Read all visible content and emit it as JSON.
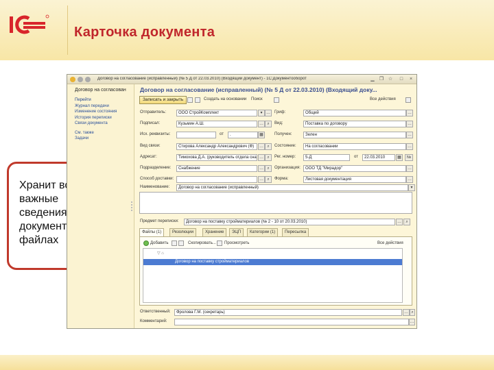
{
  "slide": {
    "title": "Карточка документа",
    "callout": "Хранит все важные сведения о документах и файлах"
  },
  "window": {
    "title": "Договор на согласование (исправленный) (№ 5 Д от 22.03.2010) (Входящий документ) - 1С:Документооборот",
    "form_title": "Договор на согласование (исправленный) (№ 5 Д от 22.03.2010) (Входящий доку...",
    "nav": {
      "header": "Договор на согласован",
      "items": [
        "Перейти",
        "Журнал передачи",
        "Изменение состояния",
        "История переписки",
        "Связи документа"
      ],
      "items2": [
        "См. также",
        "Задачи"
      ]
    },
    "toolbar": {
      "save": "Записать и закрыть",
      "create": "Создать на основании",
      "search": "Поиск",
      "all_actions": "Все действия"
    },
    "left_fields": [
      {
        "label": "Отправитель:",
        "value": "ООО СтройКомплект"
      },
      {
        "label": "Подписал:",
        "value": "Кузьмин А.Ш."
      },
      {
        "label": "Исх. реквизиты:",
        "value": "",
        "date_label": "от",
        "date": "."
      },
      {
        "label": "Вид связи:",
        "value": "Стирова Александр Александрович (Ф)"
      },
      {
        "label": "Адресат:",
        "value": "Тимохова Д.А. (руководитель отдела снаб.)"
      },
      {
        "label": "Подразделение:",
        "value": "Снабжение"
      },
      {
        "label": "Способ доставки:",
        "value": ""
      }
    ],
    "right_fields": [
      {
        "label": "Гриф:",
        "value": "Общий"
      },
      {
        "label": "Вид:",
        "value": "Поставка по договору"
      },
      {
        "label": "Получен:",
        "value": "Зелен"
      },
      {
        "label": "Состояние:",
        "value": "На согласовании"
      },
      {
        "label": "Рег. номер:",
        "value": "5-Д",
        "date_label": "от",
        "date": "22.03.2010"
      },
      {
        "label": "Организация:",
        "value": "ООО ТД \"Мирадор\""
      },
      {
        "label": "Форма:",
        "value": "Листовая документация"
      }
    ],
    "name_label": "Наименование:",
    "name_value": "Договор на согласование (исправленный)",
    "subject_label": "Предмет переписки:",
    "subject_value": "Договор на поставку стройматериалов (№ 2 - 10 от 20.03.2010)",
    "tabs": [
      "Файлы (1)",
      "Резолюции",
      "Хранение",
      "ЭЦП",
      "Категории (1)",
      "Пересылка"
    ],
    "files_toolbar": {
      "add": "Добавить",
      "create_copy": "Скопировать...",
      "view": "Просмотреть",
      "all_actions": "Все действия"
    },
    "file_row": "Договор на поставку стройматериалов",
    "responsible_label": "Ответственный:",
    "responsible_value": "Фролова Г.М. (секретарь)",
    "comment_label": "Комментарий:",
    "comment_value": ""
  }
}
